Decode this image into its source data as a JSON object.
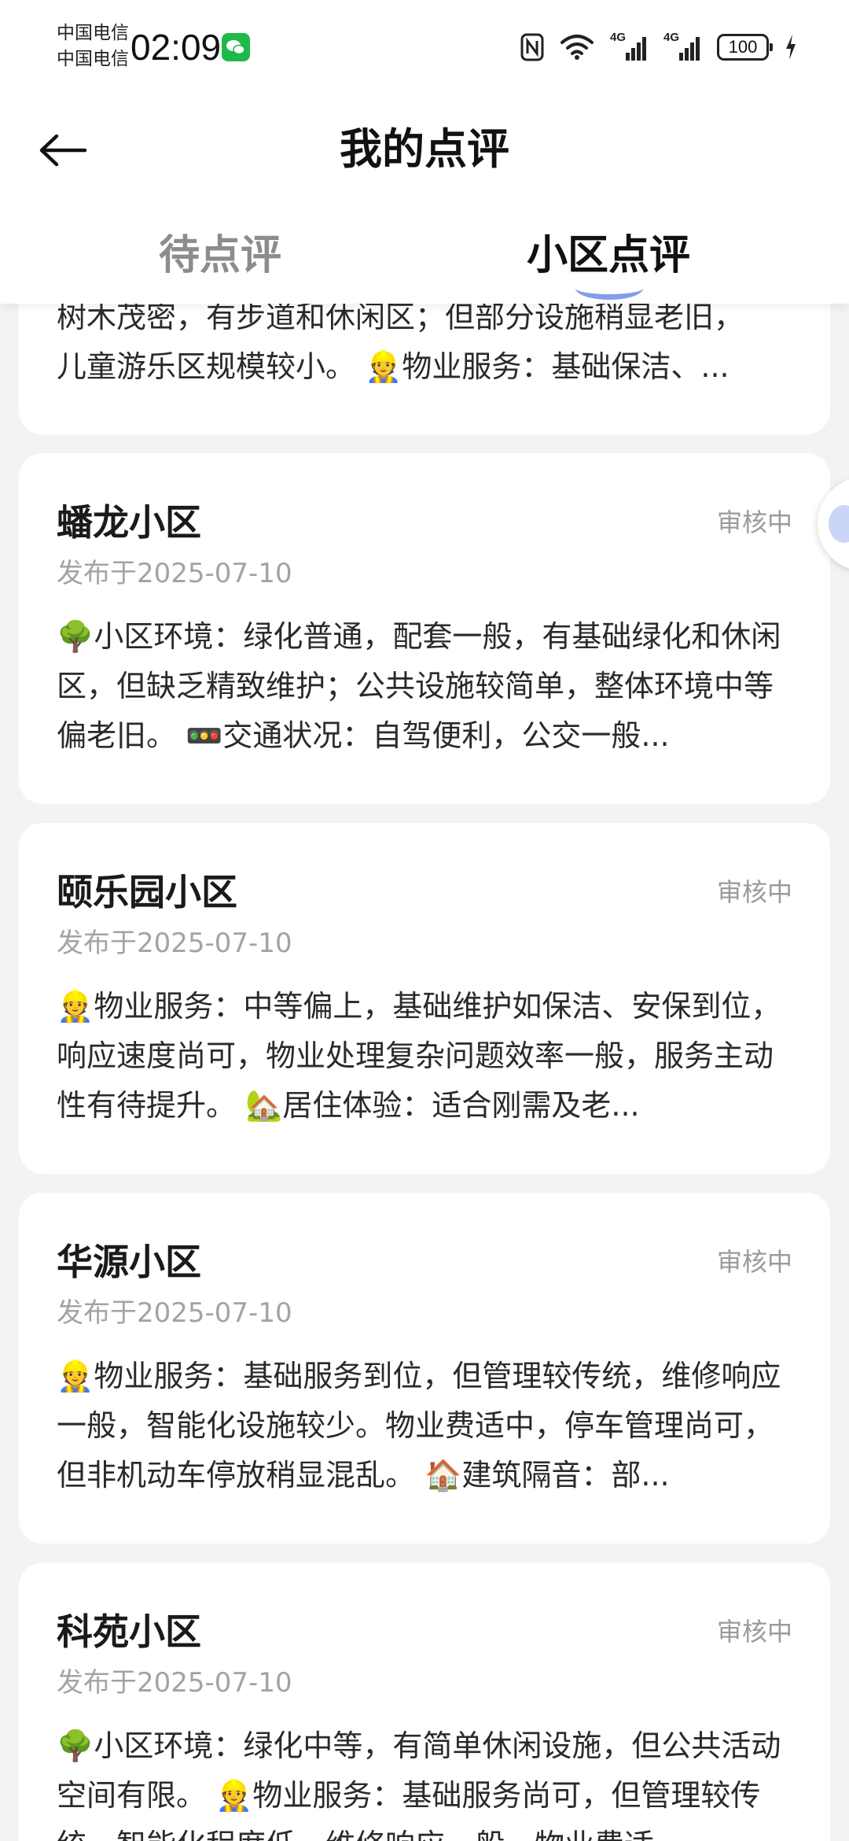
{
  "status_bar": {
    "carrier_1": "中国电信",
    "carrier_2": "中国电信",
    "time": "02:09",
    "network_1": "4G",
    "network_2": "4G",
    "battery": "100"
  },
  "header": {
    "title": "我的点评"
  },
  "tabs": [
    {
      "label": "待点评",
      "active": false
    },
    {
      "label": "小区点评",
      "active": true
    }
  ],
  "reviews": [
    {
      "lines": [
        "树木茂密，有步道和休闲区；但部分设施稍显老旧，",
        "儿童游乐区规模较小。 👷物业服务：基础保洁、..."
      ]
    },
    {
      "name": "蟠龙小区",
      "status": "审核中",
      "date": "发布于2025-07-10",
      "text": "🌳小区环境：绿化普通，配套一般，有基础绿化和休闲区，但缺乏精致维护；公共设施较简单，整体环境中等偏老旧。 🚥交通状况：自驾便利，公交一般..."
    },
    {
      "name": "颐乐园小区",
      "status": "审核中",
      "date": "发布于2025-07-10",
      "text": "👷物业服务：中等偏上，基础维护如保洁、安保到位，响应速度尚可，物业处理复杂问题效率一般，服务主动性有待提升。 🏡居住体验：适合刚需及老..."
    },
    {
      "name": "华源小区",
      "status": "审核中",
      "date": "发布于2025-07-10",
      "text": "👷物业服务：基础服务到位，但管理较传统，维修响应一般，智能化设施较少。物业费适中，停车管理尚可，但非机动车停放稍显混乱。 🏠建筑隔音：部..."
    },
    {
      "name": "科苑小区",
      "status": "审核中",
      "date": "发布于2025-07-10",
      "text": "🌳小区环境：绿化中等，有简单休闲设施，但公共活动空间有限。 👷物业服务：基础服务尚可，但管理较传统，智能化程度低，维修响应一般，物业费适..."
    }
  ]
}
